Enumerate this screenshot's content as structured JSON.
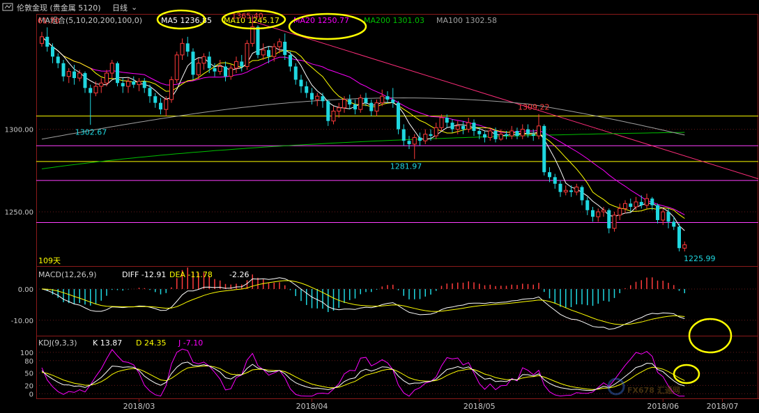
{
  "toolbar": {
    "title": "伦敦金现 (贵金属 5120)",
    "period": "日线"
  },
  "colors": {
    "up": "#ff3b3b",
    "down": "#1fd7e0",
    "ma5": "#ffffff",
    "ma10": "#ffff00",
    "ma20": "#ff00ff",
    "ma200": "#00c000",
    "ma100": "#a0a0a0",
    "trendline": "#ff2d7a",
    "highlight": "#ffff00"
  },
  "chart_data": {
    "type": "candlestick",
    "main_panel": {
      "indicator": "MA组合(5,10,20,200,100,0)",
      "legend": [
        {
          "name": "MA5",
          "value": "1236.85",
          "color": "#ffffff"
        },
        {
          "name": "MA10",
          "value": "1245.17",
          "color": "#ffff00"
        },
        {
          "name": "MA20",
          "value": "1250.77",
          "color": "#ff00ff"
        },
        {
          "name": "MA200",
          "value": "1301.03",
          "color": "#00c000"
        },
        {
          "name": "MA100",
          "value": "1302.58",
          "color": "#a0a0a0"
        }
      ],
      "y_ticks": [
        1300.0,
        1250.0
      ],
      "y_tick_labels": [
        "1300.00",
        "1250.00"
      ],
      "ylim": [
        1218,
        1369
      ],
      "annotations": [
        {
          "text": "61.70",
          "value": 1361.7
        },
        {
          "text": "1365.40",
          "value": 1365.4
        },
        {
          "text": "1302.67",
          "value": 1302.67
        },
        {
          "text": "1281.97",
          "value": 1281.97
        },
        {
          "text": "1309.22",
          "value": 1309.22
        },
        {
          "text": "1225.99",
          "value": 1225.99
        }
      ],
      "days_label": "109天",
      "horizontal_levels": [
        {
          "value": 1308.0,
          "color": "#ffff00"
        },
        {
          "value": 1290.0,
          "color": "#ff3fff"
        },
        {
          "value": 1280.5,
          "color": "#ffff00"
        },
        {
          "value": 1269.0,
          "color": "#ff3fff"
        },
        {
          "value": 1243.5,
          "color": "#ff3fff"
        }
      ],
      "candles": [
        {
          "o": 1352,
          "c": 1356,
          "h": 1359,
          "l": 1350
        },
        {
          "o": 1356,
          "c": 1350,
          "h": 1361.7,
          "l": 1347
        },
        {
          "o": 1350,
          "c": 1344,
          "h": 1352,
          "l": 1340
        },
        {
          "o": 1344,
          "c": 1340,
          "h": 1346,
          "l": 1337
        },
        {
          "o": 1340,
          "c": 1332,
          "h": 1342,
          "l": 1329
        },
        {
          "o": 1332,
          "c": 1335,
          "h": 1337,
          "l": 1328
        },
        {
          "o": 1335,
          "c": 1331,
          "h": 1339,
          "l": 1327
        },
        {
          "o": 1331,
          "c": 1334,
          "h": 1336,
          "l": 1329
        },
        {
          "o": 1334,
          "c": 1325,
          "h": 1335,
          "l": 1322
        },
        {
          "o": 1325,
          "c": 1322,
          "h": 1327,
          "l": 1302.67
        },
        {
          "o": 1322,
          "c": 1326,
          "h": 1329,
          "l": 1320
        },
        {
          "o": 1326,
          "c": 1328,
          "h": 1331,
          "l": 1322
        },
        {
          "o": 1328,
          "c": 1334,
          "h": 1336,
          "l": 1326
        },
        {
          "o": 1334,
          "c": 1340,
          "h": 1342,
          "l": 1331
        },
        {
          "o": 1340,
          "c": 1328,
          "h": 1341,
          "l": 1326
        },
        {
          "o": 1328,
          "c": 1326,
          "h": 1331,
          "l": 1322
        },
        {
          "o": 1326,
          "c": 1329,
          "h": 1331,
          "l": 1322
        },
        {
          "o": 1329,
          "c": 1327,
          "h": 1332,
          "l": 1325
        },
        {
          "o": 1327,
          "c": 1329,
          "h": 1331,
          "l": 1323
        },
        {
          "o": 1329,
          "c": 1325,
          "h": 1331,
          "l": 1322
        },
        {
          "o": 1325,
          "c": 1320,
          "h": 1327,
          "l": 1316
        },
        {
          "o": 1320,
          "c": 1316,
          "h": 1322,
          "l": 1313
        },
        {
          "o": 1316,
          "c": 1312,
          "h": 1319,
          "l": 1309
        },
        {
          "o": 1312,
          "c": 1318,
          "h": 1320,
          "l": 1308
        },
        {
          "o": 1318,
          "c": 1330,
          "h": 1332,
          "l": 1316
        },
        {
          "o": 1330,
          "c": 1345,
          "h": 1347,
          "l": 1328
        },
        {
          "o": 1345,
          "c": 1352,
          "h": 1355,
          "l": 1342
        },
        {
          "o": 1352,
          "c": 1347,
          "h": 1356,
          "l": 1344
        },
        {
          "o": 1347,
          "c": 1333,
          "h": 1349,
          "l": 1330
        },
        {
          "o": 1333,
          "c": 1340,
          "h": 1343,
          "l": 1330
        },
        {
          "o": 1340,
          "c": 1344,
          "h": 1346,
          "l": 1336
        },
        {
          "o": 1344,
          "c": 1337,
          "h": 1347,
          "l": 1334
        },
        {
          "o": 1337,
          "c": 1335,
          "h": 1340,
          "l": 1332
        },
        {
          "o": 1335,
          "c": 1338,
          "h": 1342,
          "l": 1333
        },
        {
          "o": 1338,
          "c": 1332,
          "h": 1341,
          "l": 1329
        },
        {
          "o": 1332,
          "c": 1337,
          "h": 1339,
          "l": 1330
        },
        {
          "o": 1337,
          "c": 1341,
          "h": 1344,
          "l": 1334
        },
        {
          "o": 1341,
          "c": 1338,
          "h": 1345,
          "l": 1335
        },
        {
          "o": 1338,
          "c": 1352,
          "h": 1354,
          "l": 1336
        },
        {
          "o": 1352,
          "c": 1362,
          "h": 1365.4,
          "l": 1350
        },
        {
          "o": 1362,
          "c": 1345,
          "h": 1363,
          "l": 1343
        },
        {
          "o": 1345,
          "c": 1348,
          "h": 1352,
          "l": 1342
        },
        {
          "o": 1348,
          "c": 1344,
          "h": 1350,
          "l": 1340
        },
        {
          "o": 1344,
          "c": 1350,
          "h": 1352,
          "l": 1341
        },
        {
          "o": 1350,
          "c": 1353,
          "h": 1355,
          "l": 1346
        },
        {
          "o": 1353,
          "c": 1345,
          "h": 1358,
          "l": 1342
        },
        {
          "o": 1345,
          "c": 1338,
          "h": 1347,
          "l": 1335
        },
        {
          "o": 1338,
          "c": 1330,
          "h": 1340,
          "l": 1327
        },
        {
          "o": 1330,
          "c": 1326,
          "h": 1333,
          "l": 1322
        },
        {
          "o": 1326,
          "c": 1322,
          "h": 1329,
          "l": 1319
        },
        {
          "o": 1322,
          "c": 1318,
          "h": 1325,
          "l": 1315
        },
        {
          "o": 1318,
          "c": 1320,
          "h": 1322,
          "l": 1314
        },
        {
          "o": 1320,
          "c": 1317,
          "h": 1322,
          "l": 1313
        },
        {
          "o": 1317,
          "c": 1305,
          "h": 1318,
          "l": 1302
        },
        {
          "o": 1305,
          "c": 1311,
          "h": 1314,
          "l": 1303
        },
        {
          "o": 1311,
          "c": 1313,
          "h": 1316,
          "l": 1307
        },
        {
          "o": 1313,
          "c": 1318,
          "h": 1320,
          "l": 1310
        },
        {
          "o": 1318,
          "c": 1315,
          "h": 1321,
          "l": 1312
        },
        {
          "o": 1315,
          "c": 1312,
          "h": 1318,
          "l": 1309
        },
        {
          "o": 1312,
          "c": 1319,
          "h": 1321,
          "l": 1310
        },
        {
          "o": 1319,
          "c": 1316,
          "h": 1322,
          "l": 1314
        },
        {
          "o": 1316,
          "c": 1311,
          "h": 1318,
          "l": 1308
        },
        {
          "o": 1311,
          "c": 1316,
          "h": 1318,
          "l": 1308
        },
        {
          "o": 1316,
          "c": 1320,
          "h": 1324,
          "l": 1314
        },
        {
          "o": 1320,
          "c": 1318,
          "h": 1323,
          "l": 1316
        },
        {
          "o": 1318,
          "c": 1316,
          "h": 1325,
          "l": 1313
        },
        {
          "o": 1316,
          "c": 1300,
          "h": 1317,
          "l": 1297
        },
        {
          "o": 1300,
          "c": 1293,
          "h": 1303,
          "l": 1290
        },
        {
          "o": 1293,
          "c": 1291,
          "h": 1296,
          "l": 1288
        },
        {
          "o": 1291,
          "c": 1295,
          "h": 1297,
          "l": 1281.97
        },
        {
          "o": 1295,
          "c": 1293,
          "h": 1298,
          "l": 1290
        },
        {
          "o": 1293,
          "c": 1297,
          "h": 1300,
          "l": 1291
        },
        {
          "o": 1297,
          "c": 1296,
          "h": 1300,
          "l": 1293
        },
        {
          "o": 1296,
          "c": 1301,
          "h": 1304,
          "l": 1294
        },
        {
          "o": 1301,
          "c": 1307,
          "h": 1309,
          "l": 1299
        },
        {
          "o": 1307,
          "c": 1304,
          "h": 1309,
          "l": 1301
        },
        {
          "o": 1304,
          "c": 1300,
          "h": 1306,
          "l": 1298
        },
        {
          "o": 1300,
          "c": 1302,
          "h": 1305,
          "l": 1297
        },
        {
          "o": 1302,
          "c": 1300,
          "h": 1305,
          "l": 1297
        },
        {
          "o": 1300,
          "c": 1304,
          "h": 1307,
          "l": 1298
        },
        {
          "o": 1304,
          "c": 1299,
          "h": 1306,
          "l": 1296
        },
        {
          "o": 1299,
          "c": 1297,
          "h": 1301,
          "l": 1294
        },
        {
          "o": 1297,
          "c": 1295,
          "h": 1299,
          "l": 1292
        },
        {
          "o": 1295,
          "c": 1299,
          "h": 1301,
          "l": 1293
        },
        {
          "o": 1299,
          "c": 1294,
          "h": 1301,
          "l": 1292
        },
        {
          "o": 1294,
          "c": 1297,
          "h": 1300,
          "l": 1293
        },
        {
          "o": 1297,
          "c": 1296,
          "h": 1299,
          "l": 1294
        },
        {
          "o": 1296,
          "c": 1299,
          "h": 1302,
          "l": 1294
        },
        {
          "o": 1299,
          "c": 1296,
          "h": 1301,
          "l": 1294
        },
        {
          "o": 1296,
          "c": 1300,
          "h": 1303,
          "l": 1294
        },
        {
          "o": 1300,
          "c": 1297,
          "h": 1303,
          "l": 1295
        },
        {
          "o": 1297,
          "c": 1296,
          "h": 1300,
          "l": 1293
        },
        {
          "o": 1296,
          "c": 1302,
          "h": 1309.22,
          "l": 1294
        },
        {
          "o": 1302,
          "c": 1274,
          "h": 1303,
          "l": 1272
        },
        {
          "o": 1274,
          "c": 1271,
          "h": 1277,
          "l": 1268
        },
        {
          "o": 1271,
          "c": 1267,
          "h": 1273,
          "l": 1264
        },
        {
          "o": 1267,
          "c": 1262,
          "h": 1269,
          "l": 1259
        },
        {
          "o": 1262,
          "c": 1263,
          "h": 1266,
          "l": 1260
        },
        {
          "o": 1263,
          "c": 1262,
          "h": 1266,
          "l": 1259
        },
        {
          "o": 1262,
          "c": 1265,
          "h": 1267,
          "l": 1260
        },
        {
          "o": 1265,
          "c": 1257,
          "h": 1266,
          "l": 1254
        },
        {
          "o": 1257,
          "c": 1251,
          "h": 1259,
          "l": 1248
        },
        {
          "o": 1251,
          "c": 1247,
          "h": 1253,
          "l": 1244
        },
        {
          "o": 1247,
          "c": 1250,
          "h": 1252,
          "l": 1244
        },
        {
          "o": 1250,
          "c": 1251,
          "h": 1253,
          "l": 1247
        },
        {
          "o": 1251,
          "c": 1240,
          "h": 1252,
          "l": 1237
        },
        {
          "o": 1240,
          "c": 1248,
          "h": 1250,
          "l": 1238
        },
        {
          "o": 1248,
          "c": 1252,
          "h": 1255,
          "l": 1245
        },
        {
          "o": 1252,
          "c": 1255,
          "h": 1257,
          "l": 1249
        },
        {
          "o": 1255,
          "c": 1253,
          "h": 1258,
          "l": 1250
        },
        {
          "o": 1253,
          "c": 1256,
          "h": 1259,
          "l": 1251
        },
        {
          "o": 1256,
          "c": 1254,
          "h": 1260,
          "l": 1252
        },
        {
          "o": 1254,
          "c": 1258,
          "h": 1261,
          "l": 1252
        },
        {
          "o": 1258,
          "c": 1254,
          "h": 1259,
          "l": 1251
        },
        {
          "o": 1254,
          "c": 1245,
          "h": 1255,
          "l": 1243
        },
        {
          "o": 1245,
          "c": 1250,
          "h": 1252,
          "l": 1242
        },
        {
          "o": 1250,
          "c": 1244,
          "h": 1252,
          "l": 1240
        },
        {
          "o": 1244,
          "c": 1241,
          "h": 1247,
          "l": 1239
        },
        {
          "o": 1241,
          "c": 1228,
          "h": 1243,
          "l": 1225.99
        },
        {
          "o": 1228,
          "c": 1230,
          "h": 1232,
          "l": 1226
        }
      ]
    },
    "macd_panel": {
      "indicator": "MACD(12,26,9)",
      "legend": [
        {
          "name": "DIFF",
          "value": "-12.91",
          "color": "#ffffff"
        },
        {
          "name": "DEA",
          "value": "-11.78",
          "color": "#ffff00"
        },
        {
          "name": "",
          "value": "-2.26",
          "color": "#ffffff"
        }
      ],
      "y_ticks": [
        0,
        -10
      ],
      "y_tick_labels": [
        "0.00",
        "-10.00"
      ],
      "ylim": [
        -14.5,
        4
      ]
    },
    "kdj_panel": {
      "indicator": "KDJ(9,3,3)",
      "legend": [
        {
          "name": "K",
          "value": "13.87",
          "color": "#ffffff"
        },
        {
          "name": "D",
          "value": "24.35",
          "color": "#ffff00"
        },
        {
          "name": "J",
          "value": "-7.10",
          "color": "#ff00ff"
        }
      ],
      "y_ticks": [
        100,
        80,
        50,
        20,
        0
      ],
      "y_tick_labels": [
        "100",
        "80",
        "50",
        "20",
        "0"
      ],
      "ylim": [
        -8,
        110
      ]
    },
    "x_tick_labels": [
      "2018/03",
      "2018/04",
      "2018/05",
      "2018/06",
      "2018/07"
    ],
    "x_tick_candles": [
      18,
      50,
      81,
      115,
      126
    ],
    "watermark": "FX678 汇通网"
  }
}
